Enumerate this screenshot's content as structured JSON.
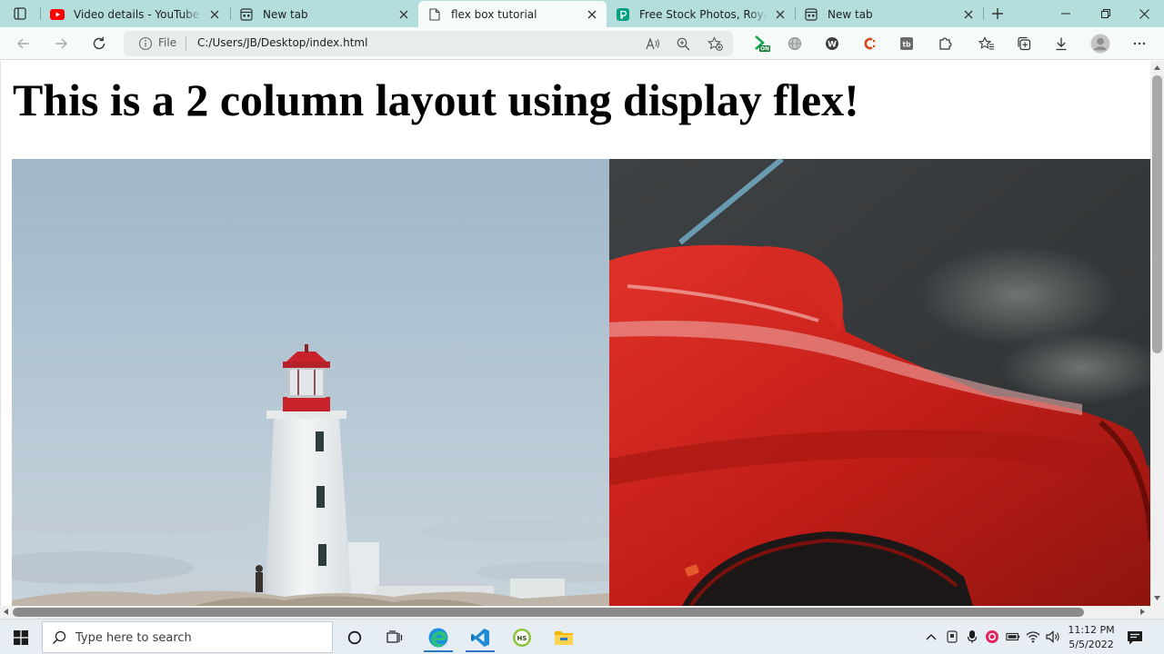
{
  "tabs": [
    {
      "title": "Video details - YouTube Studio",
      "favicon": "youtube-icon",
      "active": false
    },
    {
      "title": "New tab",
      "favicon": "newtab-icon",
      "active": false
    },
    {
      "title": "flex box tutorial",
      "favicon": "document-icon",
      "active": true
    },
    {
      "title": "Free Stock Photos, Royalty Free",
      "favicon": "pexels-icon",
      "active": false
    },
    {
      "title": "New tab",
      "favicon": "newtab-icon",
      "active": false
    }
  ],
  "address": {
    "scheme_label": "File",
    "url": "C:/Users/JB/Desktop/index.html"
  },
  "page": {
    "heading": "This is a 2 column layout using display flex!"
  },
  "taskbar": {
    "search_placeholder": "Type here to search",
    "time": "11:12 PM",
    "date": "5/5/2022"
  },
  "colors": {
    "tabstrip": "#b3dedc",
    "toolbar": "#f6fbfa",
    "accent": "#2f76c4"
  }
}
